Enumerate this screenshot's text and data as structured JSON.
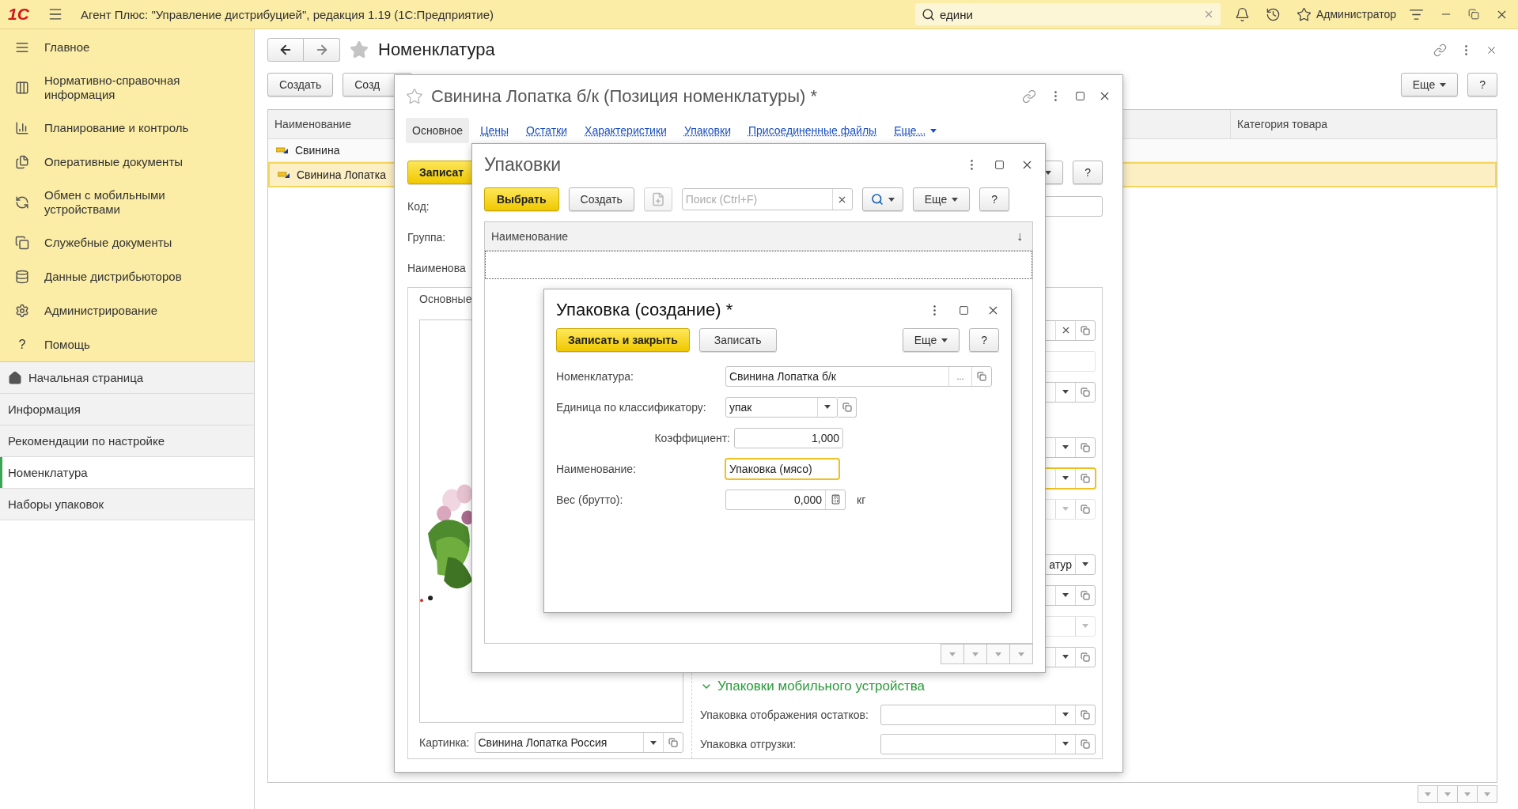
{
  "app_bar": {
    "logo": "1С",
    "title": "Агент Плюс: \"Управление дистрибуцией\", редакция 1.19  (1С:Предприятие)",
    "search": {
      "value": "едини"
    },
    "user": "Администратор"
  },
  "sections": [
    {
      "label": "Главное"
    },
    {
      "label": "Нормативно-справочная информация"
    },
    {
      "label": "Планирование и контроль"
    },
    {
      "label": "Оперативные документы"
    },
    {
      "label": "Обмен с мобильными устройствами"
    },
    {
      "label": "Служебные документы"
    },
    {
      "label": "Данные дистрибьюторов"
    },
    {
      "label": "Администрирование"
    },
    {
      "label": "Помощь",
      "glyph": "?"
    }
  ],
  "nav_panel": [
    {
      "label": "Начальная страница",
      "kind": "home",
      "selected": false
    },
    {
      "label": "Информация",
      "kind": "link",
      "selected": false
    },
    {
      "label": "Рекомендации по настройке",
      "kind": "link",
      "selected": false
    },
    {
      "label": "Номенклатура",
      "kind": "link",
      "selected": true
    },
    {
      "label": "Наборы упаковок",
      "kind": "link",
      "selected": false
    }
  ],
  "list_form": {
    "title": "Номенклатура",
    "create": "Создать",
    "create_cut": "Созд",
    "more": "Еще",
    "help": "?",
    "columns": [
      "Наименование",
      "Категория товара"
    ],
    "rows": [
      {
        "name": "Свинина",
        "selected": false
      },
      {
        "name": "Свинина Лопатка",
        "selected": true
      }
    ]
  },
  "item_window": {
    "title": "Свинина Лопатка б/к (Позиция номенклатуры) *",
    "tabs": [
      {
        "label": "Основное",
        "kind": "tab",
        "selected": true
      },
      {
        "label": "Цены",
        "kind": "tab",
        "selected": false
      },
      {
        "label": "Остатки",
        "kind": "tab",
        "selected": false
      },
      {
        "label": "Характеристики",
        "kind": "tab",
        "selected": false
      },
      {
        "label": "Упаковки",
        "kind": "tab",
        "selected": false
      },
      {
        "label": "Присоединенные файлы",
        "kind": "tab",
        "selected": false
      },
      {
        "label": "Еще...",
        "kind": "menu",
        "selected": false
      }
    ],
    "save": "Записат",
    "help": "?",
    "labels": [
      "Код:",
      "Группа:",
      "Наименова"
    ],
    "group_title": "Основные",
    "side_groups": [
      [
        {
          "kind": "clear",
          "disabled": false,
          "focused": false
        },
        {
          "kind": "plain",
          "disabled": true,
          "focused": false
        },
        {
          "kind": "select",
          "disabled": false,
          "focused": false
        }
      ],
      [
        {
          "kind": "select",
          "disabled": false,
          "focused": false
        },
        {
          "kind": "select",
          "disabled": false,
          "focused": true
        },
        {
          "kind": "select",
          "disabled": true,
          "focused": false
        }
      ],
      [
        {
          "kind": "choice",
          "value": "атур",
          "disabled": false,
          "focused": false
        },
        {
          "kind": "select",
          "disabled": false,
          "focused": false
        },
        {
          "kind": "choice",
          "disabled": true,
          "focused": false
        },
        {
          "kind": "select",
          "disabled": false,
          "focused": false
        }
      ]
    ],
    "mobile": {
      "title": "Упаковки мобильного устройства",
      "expanded": true,
      "fields": [
        {
          "label": "Упаковка отображения остатков:"
        },
        {
          "label": "Упаковка отгрузки:"
        }
      ]
    },
    "picture_field": {
      "label": "Картинка:",
      "value": "Свинина Лопатка Россия"
    }
  },
  "packs_window": {
    "title": "Упаковки",
    "choose": "Выбрать",
    "create": "Создать",
    "search_placeholder": "Поиск (Ctrl+F)",
    "more": "Еще",
    "help": "?",
    "columns": [
      "Наименование"
    ],
    "sort_mark": "↓"
  },
  "create_window": {
    "title": "Упаковка (создание) *",
    "save_close": "Записать и закрыть",
    "save": "Записать",
    "more": "Еще",
    "help": "?",
    "fields": [
      {
        "kind": "ref",
        "label": "Номенклатура:",
        "value": "Свинина Лопатка б/к",
        "choose_mark": "..."
      },
      {
        "kind": "select",
        "label": "Единица по классификатору:",
        "value": "упак"
      },
      {
        "kind": "number",
        "label": "Коэффициент:",
        "value": "1,000"
      },
      {
        "kind": "text",
        "label": "Наименование:",
        "value": "Упаковка (мясо)",
        "focused": true
      },
      {
        "kind": "calc",
        "label": "Вес (брутто):",
        "value": "0,000",
        "unit": "кг"
      }
    ]
  }
}
